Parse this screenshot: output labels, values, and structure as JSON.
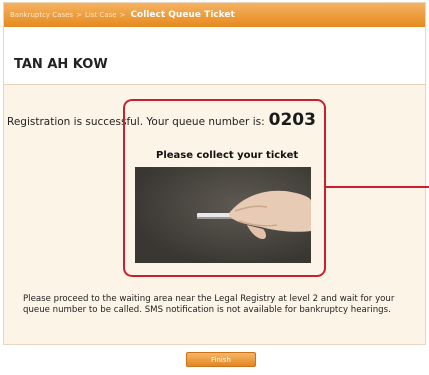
{
  "breadcrumb": {
    "items": [
      "Bankruptcy Cases",
      "List Case"
    ],
    "separator": ">",
    "current": "Collect Queue Ticket"
  },
  "header": {
    "name": "TAN AH KOW"
  },
  "registration": {
    "message": "Registration is successful. Your queue number is:",
    "queue_number": "0203"
  },
  "ticket": {
    "label": "Please collect your ticket",
    "image": "hand-holding-ticket-photo"
  },
  "instruction": "Please proceed to the waiting area near the Legal Registry at level 2 and wait for your queue number to be called. SMS notification is not available for bankruptcy hearings.",
  "footer": {
    "finish_label": "Finish"
  },
  "colors": {
    "header_orange": "#e58a1e",
    "panel_bg": "#fdf4e8",
    "highlight_red": "#c8202f"
  }
}
